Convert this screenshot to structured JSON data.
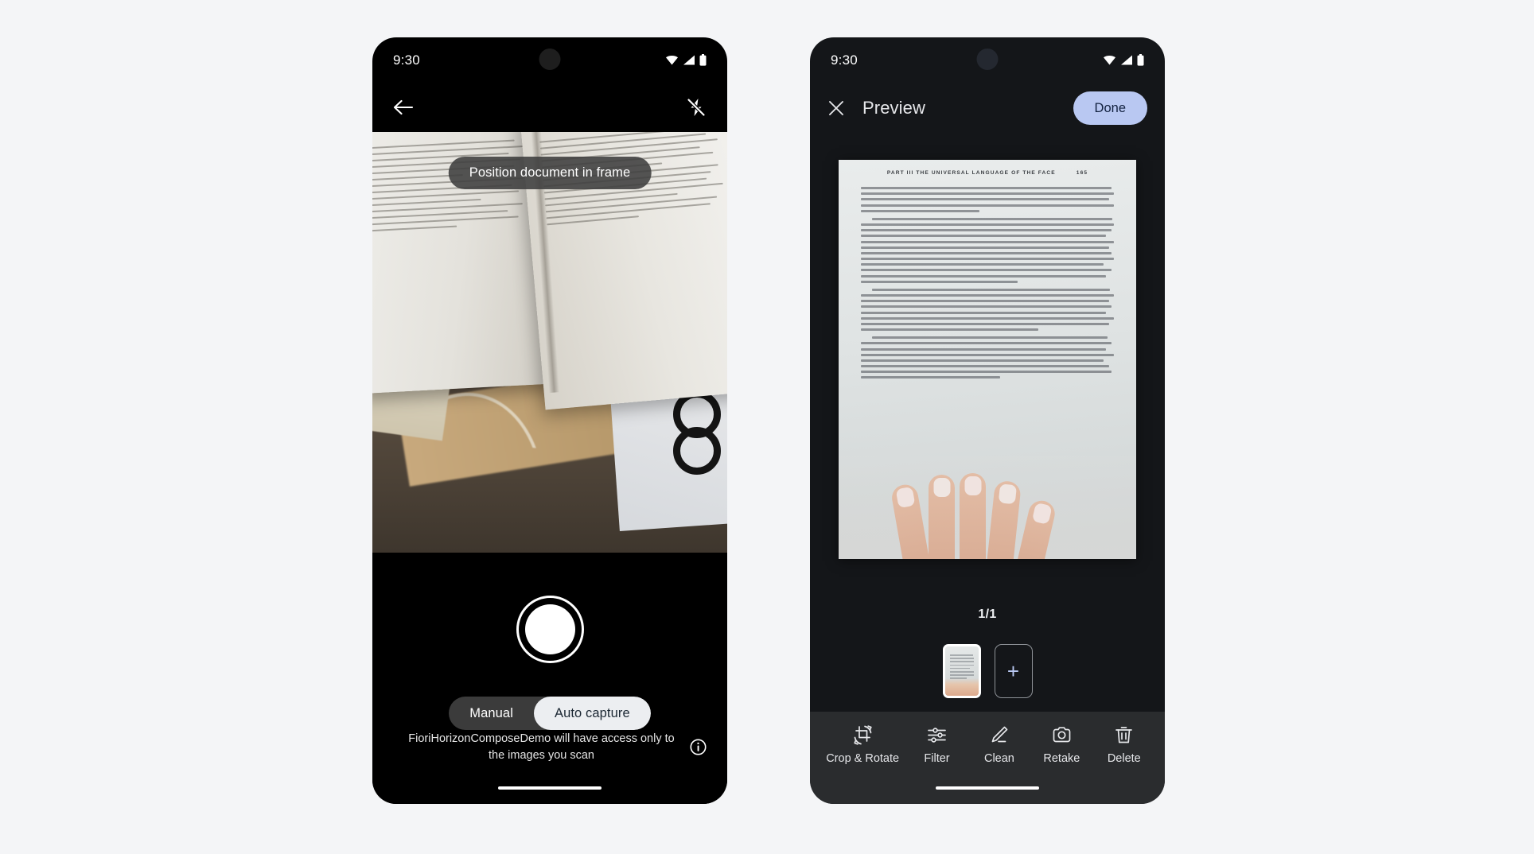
{
  "background_color": "#f4f5f7",
  "camera_screen": {
    "name": "document-scanner-camera",
    "status_bar": {
      "time": "9:30",
      "icons": [
        "wifi-icon",
        "cellular-signal-icon",
        "battery-icon"
      ]
    },
    "appbar": {
      "back_icon": "arrow-back-icon",
      "flash_icon": "flash-off-icon"
    },
    "hint": "Position document in frame",
    "shutter_label": "capture-button",
    "segmented_control": {
      "options": [
        "Manual",
        "Auto capture"
      ],
      "selected": "Auto capture"
    },
    "consent_text": "FioriHorizonComposeDemo will have access only to the images you scan",
    "info_icon": "info-icon"
  },
  "preview_screen": {
    "name": "document-scanner-preview",
    "background_color": "#141619",
    "status_bar": {
      "time": "9:30",
      "icons": [
        "wifi-icon",
        "cellular-signal-icon",
        "battery-icon"
      ]
    },
    "appbar": {
      "close_icon": "close-icon",
      "title": "Preview",
      "done_label": "Done",
      "done_color": "#b9c8f2"
    },
    "document": {
      "header_part": "PART III    THE UNIVERSAL LANGUAGE OF THE FACE",
      "header_page": "165"
    },
    "page_counter": "1/1",
    "thumbnail_name": "page-thumbnail-1",
    "add_page_label": "+",
    "toolbar": [
      {
        "label": "Crop & Rotate",
        "icon": "crop-rotate-icon"
      },
      {
        "label": "Filter",
        "icon": "filter-sliders-icon"
      },
      {
        "label": "Clean",
        "icon": "clean-pen-icon"
      },
      {
        "label": "Retake",
        "icon": "camera-icon"
      },
      {
        "label": "Delete",
        "icon": "trash-icon"
      }
    ]
  }
}
